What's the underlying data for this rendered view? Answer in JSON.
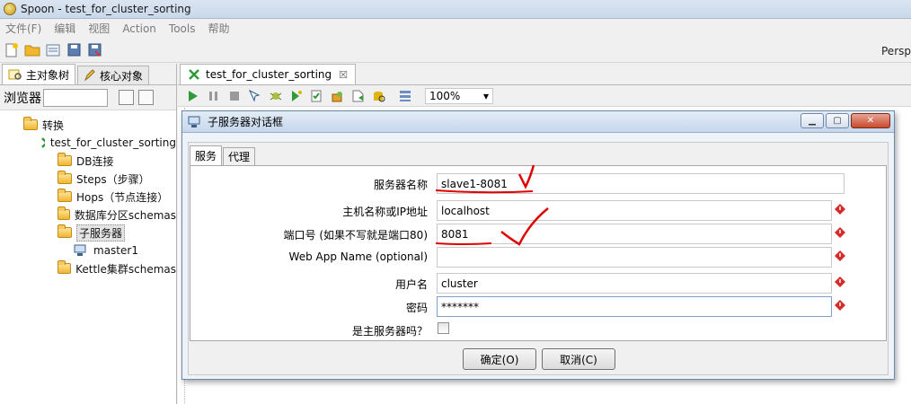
{
  "window": {
    "title": "Spoon - test_for_cluster_sorting"
  },
  "menu": [
    "文件(F)",
    "编辑",
    "视图",
    "Action",
    "Tools",
    "帮助"
  ],
  "perspective_label": "Persp",
  "left_panel": {
    "tabs": [
      "主对象树",
      "核心对象"
    ],
    "browser_label": "浏览器",
    "tree": [
      {
        "label": "转换",
        "level": 1,
        "icon": "folder-icon"
      },
      {
        "label": "test_for_cluster_sorting",
        "level": 2,
        "icon": "transformation-icon"
      },
      {
        "label": "DB连接",
        "level": 3,
        "icon": "folder-icon"
      },
      {
        "label": "Steps（步骤）",
        "level": 3,
        "icon": "folder-icon"
      },
      {
        "label": "Hops（节点连接）",
        "level": 3,
        "icon": "folder-icon"
      },
      {
        "label": "数据库分区schemas",
        "level": 3,
        "icon": "folder-icon"
      },
      {
        "label": "子服务器",
        "level": 3,
        "icon": "folder-icon",
        "selected": true
      },
      {
        "label": "master1",
        "level": 4,
        "icon": "server-icon"
      },
      {
        "label": "Kettle集群schemas",
        "level": 3,
        "icon": "folder-icon"
      }
    ]
  },
  "editor": {
    "tab_label": "test_for_cluster_sorting",
    "zoom": "100%"
  },
  "dialog": {
    "title": "子服务器对话框",
    "tabs": [
      "服务",
      "代理"
    ],
    "fields": {
      "server_name": {
        "label": "服务器名称",
        "value": "slave1-8081"
      },
      "hostname": {
        "label": "主机名称或IP地址",
        "value": "localhost"
      },
      "port": {
        "label": "端口号 (如果不写就是端口80)",
        "value": "8081"
      },
      "webapp": {
        "label": "Web App Name (optional)",
        "value": ""
      },
      "username": {
        "label": "用户名",
        "value": "cluster"
      },
      "password": {
        "label": "密码",
        "value": "*******"
      },
      "is_master": {
        "label": "是主服务器吗？",
        "checked": false
      }
    },
    "ok_button": "确定(O)",
    "cancel_button": "取消(C)"
  },
  "colors": {
    "annotation": "#e00000",
    "dialog_border": "#6d8aaa",
    "titlebar": "#c6d7ec"
  }
}
